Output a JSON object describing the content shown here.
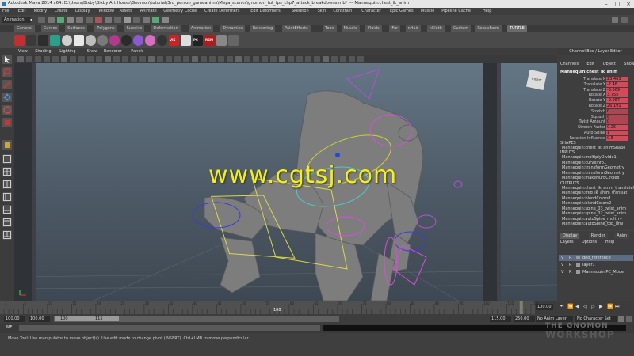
{
  "window": {
    "title": "Autodesk Maya 2014 x64: D:\\Users\\Bixby\\Bixby Art House\\Gnomon\\tutorial\\3rd_person_gameanims\\Maya_scenes\\gnomon_tut_tps_chp7_attack_breakdowns.mb* --- Mannequin:chest_ik_anim"
  },
  "menubar": [
    "File",
    "Edit",
    "Modify",
    "Create",
    "Display",
    "Window",
    "Assets",
    "Animate",
    "Geometry Cache",
    "Create Deformers",
    "Edit Deformers",
    "Skeleton",
    "Skin",
    "Constrain",
    "Character",
    "Epic Games",
    "Muscle",
    "Pipeline Cache",
    "Help"
  ],
  "status": {
    "mode": "Animation"
  },
  "shelf_tabs": [
    "General",
    "Curves",
    "Surfaces",
    "Polygons",
    "Subdivs",
    "Deformation",
    "Animation",
    "Dynamics",
    "Rendering",
    "PaintEffects",
    "Toon",
    "Muscle",
    "Fluids",
    "Fur",
    "nHair",
    "nCloth",
    "Custom",
    "RebusFarm",
    "TURTLE"
  ],
  "shelf_icons": [
    {
      "name": "dynamite-icon",
      "color": "#c03030",
      "label": ""
    },
    {
      "name": "curve-tool-icon",
      "color": "#3a3a3a",
      "label": ""
    },
    {
      "name": "select-icon",
      "color": "#2d2d2d",
      "label": ""
    },
    {
      "name": "teal-icon",
      "color": "#2aa08a",
      "label": ""
    },
    {
      "name": "white-sphere-icon",
      "color": "#cfcfcf",
      "label": ""
    },
    {
      "name": "light-icon",
      "color": "#e8e8e8",
      "label": ""
    },
    {
      "name": "white-sphere-icon-2",
      "color": "#bdbdbd",
      "label": ""
    },
    {
      "name": "shader-sphere-icon",
      "color": "#7a7a7a",
      "label": ""
    },
    {
      "name": "color-sphere-icon",
      "color": "#b13b8a",
      "label": ""
    },
    {
      "name": "dark-sphere-icon",
      "color": "#2b2b2b",
      "label": ""
    },
    {
      "name": "gradient-sphere-icon",
      "color": "#8a5bd0",
      "label": ""
    },
    {
      "name": "pink-sphere-icon",
      "color": "#d76ec0",
      "label": ""
    },
    {
      "name": "dark-sphere-icon-2",
      "color": "#333333",
      "label": ""
    },
    {
      "name": "vis-icon",
      "color": "#c22",
      "label": "VIS"
    },
    {
      "name": "cube-icon",
      "color": "#ddd",
      "label": ""
    },
    {
      "name": "pc-icon",
      "color": "#222",
      "label": "PC"
    },
    {
      "name": "rcm-icon",
      "color": "#b01c1c",
      "label": "RCM"
    },
    {
      "name": "checker-icon",
      "color": "#888",
      "label": ""
    },
    {
      "name": "gear-shelf-icon",
      "color": "#666",
      "label": ""
    }
  ],
  "viewport": {
    "menu": [
      "View",
      "Shading",
      "Lighting",
      "Show",
      "Renderer",
      "Panels"
    ],
    "cube_label": "RIGHT",
    "watermark": "www.cgtsj.com"
  },
  "channel_box": {
    "title": "Channel Box / Layer Editor",
    "menu": [
      "Channels",
      "Edit",
      "Object",
      "Show"
    ],
    "object": "Mannequin:chest_ik_anim",
    "attributes": [
      {
        "label": "Translate X",
        "value": "23.463"
      },
      {
        "label": "Translate Y",
        "value": "-2.48"
      },
      {
        "label": "Translate Z",
        "value": "-6.569"
      },
      {
        "label": "Rotate X",
        "value": "3.755"
      },
      {
        "label": "Rotate Y",
        "value": "-9.967"
      },
      {
        "label": "Rotate Z",
        "value": "26.191"
      },
      {
        "label": "Stretch",
        "value": "0"
      },
      {
        "label": "Squash",
        "value": "0"
      },
      {
        "label": "Twist Amount",
        "value": "0"
      },
      {
        "label": "Stretch Factor",
        "value": "0.25"
      },
      {
        "label": "Auto Spine",
        "value": "1"
      },
      {
        "label": "Rotation Influence",
        "value": "0.5"
      }
    ],
    "shapes_header": "SHAPES",
    "shapes": [
      "Mannequin:chest_ik_animShape"
    ],
    "inputs_header": "INPUTS",
    "inputs": [
      "Mannequin:multiplyDivide1",
      "Mannequin:curveInfo1",
      "Mannequin:transformGeometry",
      "Mannequin:transformGeometry",
      "Mannequin:makeNurbCircle8"
    ],
    "outputs_header": "OUTPUTS",
    "outputs": [
      "Mannequin:chest_ik_anim_translateX",
      "Mannequin:mid_ik_anim_translat",
      "Mannequin:blendColors1",
      "Mannequin:blendColors2",
      "Mannequin:spine_03_twist_anim",
      "Mannequin:spine_02_twist_anim",
      "Mannequin:autoSpine_mult_rv",
      "Mannequin:autoSpine_top_driv"
    ]
  },
  "layer_editor": {
    "tabs": [
      "Display",
      "Render",
      "Anim"
    ],
    "menu": [
      "Layers",
      "Options",
      "Help"
    ],
    "layers": [
      {
        "v": "V",
        "p": "R",
        "name": "geo_reference"
      },
      {
        "v": "V",
        "p": "R",
        "name": "layer1"
      },
      {
        "v": "V",
        "p": "R",
        "name": "Mannequin:PC_Model"
      }
    ]
  },
  "timeline": {
    "ticks": [
      "1",
      "5",
      "10",
      "15",
      "20",
      "25",
      "30",
      "35",
      "40",
      "45",
      "50",
      "55",
      "60",
      "65",
      "70",
      "75",
      "80",
      "85",
      "90",
      "95",
      "100",
      "105",
      "110"
    ],
    "current_frame": "108",
    "end_field": "100.00",
    "range_start": "100.00",
    "range_inner_start": "100.00",
    "range_bar_start": "100",
    "range_bar_end": "115",
    "range_end_inner": "115.00",
    "range_end": "250.00",
    "anim_layer": "No Anim Layer",
    "character_set": "No Character Set"
  },
  "cmdline": {
    "label": "MEL"
  },
  "helpline": {
    "text": "Move Tool: Use manipulator to move object(s). Use edit mode to change pivot (INSERT). Ctrl+LMB to move perpendicular."
  },
  "brand": {
    "line1": "THE GNOMON",
    "line2": "WORKSHOP"
  }
}
